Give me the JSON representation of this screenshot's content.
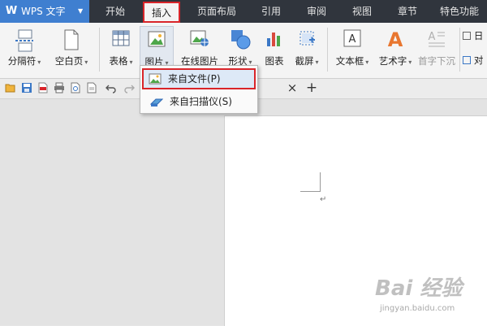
{
  "app": {
    "title": "WPS 文字",
    "logo": "W"
  },
  "menu": {
    "items": [
      {
        "label": "开始"
      },
      {
        "label": "插入"
      },
      {
        "label": "页面布局"
      },
      {
        "label": "引用"
      },
      {
        "label": "审阅"
      },
      {
        "label": "视图"
      },
      {
        "label": "章节"
      },
      {
        "label": "特色功能"
      }
    ],
    "active": "插入"
  },
  "ribbon": {
    "page_break": "分隔符",
    "blank_page": "空白页",
    "table": "表格",
    "picture": "图片",
    "online_picture": "在线图片",
    "shape": "形状",
    "chart": "图表",
    "screenshot": "截屏",
    "textbox": "文本框",
    "wordart": "艺术字",
    "drop_cap": "首字下沉",
    "date_partial": "日",
    "object_partial": "对"
  },
  "dropdown": {
    "from_file": "来自文件(P)",
    "from_scanner": "来自扫描仪(S)"
  },
  "tabs": {
    "close": "×",
    "new": "+"
  },
  "document": {
    "pilcrow": "↵"
  },
  "watermark": {
    "brand": "Bai 经验",
    "sub": "jingyan.baidu.com"
  },
  "colors": {
    "accent": "#3f7fd0",
    "highlight": "#d9252a",
    "menubar": "#30353d"
  }
}
